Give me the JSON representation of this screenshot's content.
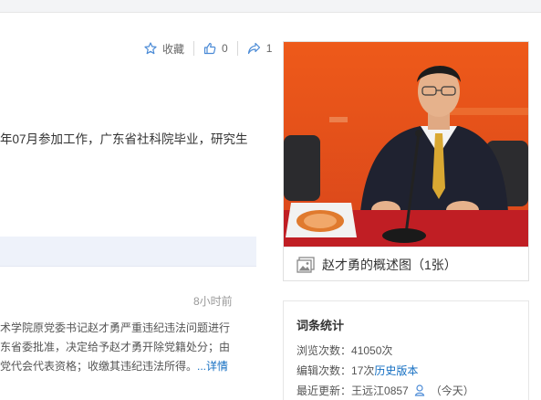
{
  "actions": {
    "favorite_label": "收藏",
    "like_count": "0",
    "share_count": "1"
  },
  "summary": {
    "text": "年07月参加工作，广东省社科院毕业，研究生"
  },
  "news": {
    "time": "8小时前",
    "lines": [
      "术学院原党委书记赵才勇严重违纪违法问题进行",
      "东省委批准，决定给予赵才勇开除党籍处分；由",
      "党代会代表资格；收缴其违纪违法所得。"
    ],
    "more_label": "...详情"
  },
  "photo": {
    "caption": "赵才勇的概述图（1张）"
  },
  "stats": {
    "title": "词条统计",
    "views_label": "浏览次数：",
    "views_value": "41050次",
    "edits_label": "编辑次数：",
    "edits_value": "17次",
    "history_link": "历史版本",
    "updated_label": "最近更新：",
    "updated_user": "王远江0857",
    "updated_when": "（今天）"
  },
  "colors": {
    "link": "#136ec2",
    "news_header_bg": "#eef2fa",
    "photo_backdrop": "#e8551c"
  }
}
